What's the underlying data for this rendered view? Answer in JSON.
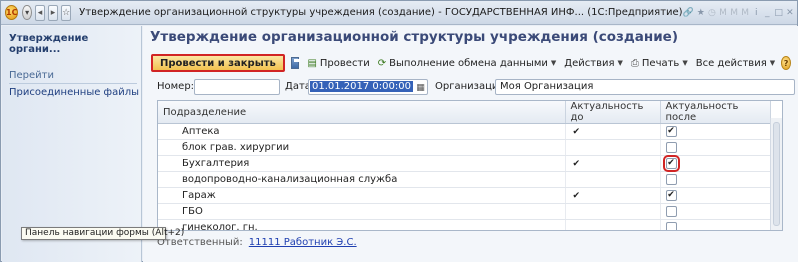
{
  "window": {
    "title": "Утверждение организационной структуры учреждения (создание) - ГОСУДАРСТВЕННАЯ ИНФ...   (1С:Предприятие)"
  },
  "sidebar": {
    "header": "Утверждение органи...",
    "nav_section": "Перейти",
    "items": [
      {
        "label": "Присоединенные файлы"
      }
    ]
  },
  "form": {
    "title": "Утверждение организационной структуры учреждения (создание)"
  },
  "toolbar": {
    "post_close_label": "Провести и закрыть",
    "post_label": "Провести",
    "exchange_label": "Выполнение обмена данными",
    "actions_label": "Действия",
    "print_label": "Печать",
    "all_actions_label": "Все действия",
    "help_label": "?"
  },
  "fields": {
    "number_label": "Номер:",
    "number_value": "",
    "date_label": "Дата:",
    "date_value": "01.01.2017  0:00:00",
    "org_label": "Организация:",
    "org_value": "Моя Организация"
  },
  "table": {
    "columns": [
      "Подразделение",
      "Актуальность до",
      "Актуальность после"
    ],
    "rows": [
      {
        "name": "Аптека",
        "before": "✔",
        "after": true
      },
      {
        "name": "блок грав. хирургии",
        "before": "",
        "after": false
      },
      {
        "name": "Бухгалтерия",
        "before": "✔",
        "after": true
      },
      {
        "name": "водопроводно-канализационная служба",
        "before": "",
        "after": false
      },
      {
        "name": "Гараж",
        "before": "✔",
        "after": true
      },
      {
        "name": "ГБО",
        "before": "",
        "after": false
      },
      {
        "name": "гинеколог. гн.",
        "before": "",
        "after": false
      }
    ]
  },
  "footer": {
    "responsible_label": "Ответственный:",
    "responsible_value": "11111 Работник Э.С."
  },
  "tooltip": {
    "text": "Панель навигации формы (Alt+2)"
  },
  "colors": {
    "highlight": "#d12424",
    "primary_button": "#f2c24f",
    "link": "#1f3fb0"
  }
}
